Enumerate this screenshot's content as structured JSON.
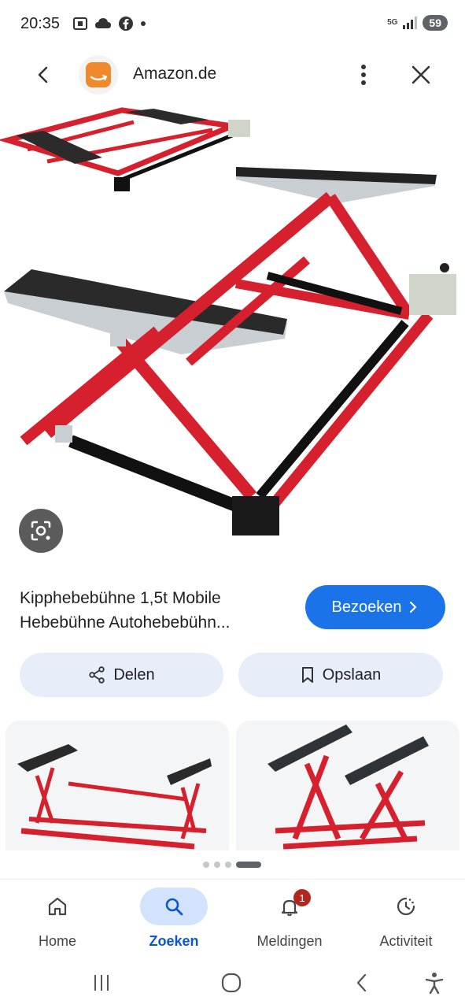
{
  "status_bar": {
    "time": "20:35",
    "network": "5G",
    "battery": "59"
  },
  "header": {
    "site_title": "Amazon.de"
  },
  "product": {
    "title_line1": "Kipphebebühne 1,5t Mobile",
    "title_line2": "Hebebühne Autohebebühn..."
  },
  "actions": {
    "visit_label": "Bezoeken",
    "share_label": "Delen",
    "save_label": "Opslaan"
  },
  "bottom_nav": {
    "items": [
      {
        "label": "Home",
        "icon": "home-icon"
      },
      {
        "label": "Zoeken",
        "icon": "search-icon"
      },
      {
        "label": "Meldingen",
        "icon": "bell-icon",
        "badge": "1"
      },
      {
        "label": "Activiteit",
        "icon": "activity-icon"
      }
    ]
  },
  "colors": {
    "accent": "#1a73e8",
    "chip_bg": "#e8eef9",
    "nav_active_bg": "#d3e3fd",
    "lift_red": "#d6202e",
    "badge": "#b3261e"
  }
}
